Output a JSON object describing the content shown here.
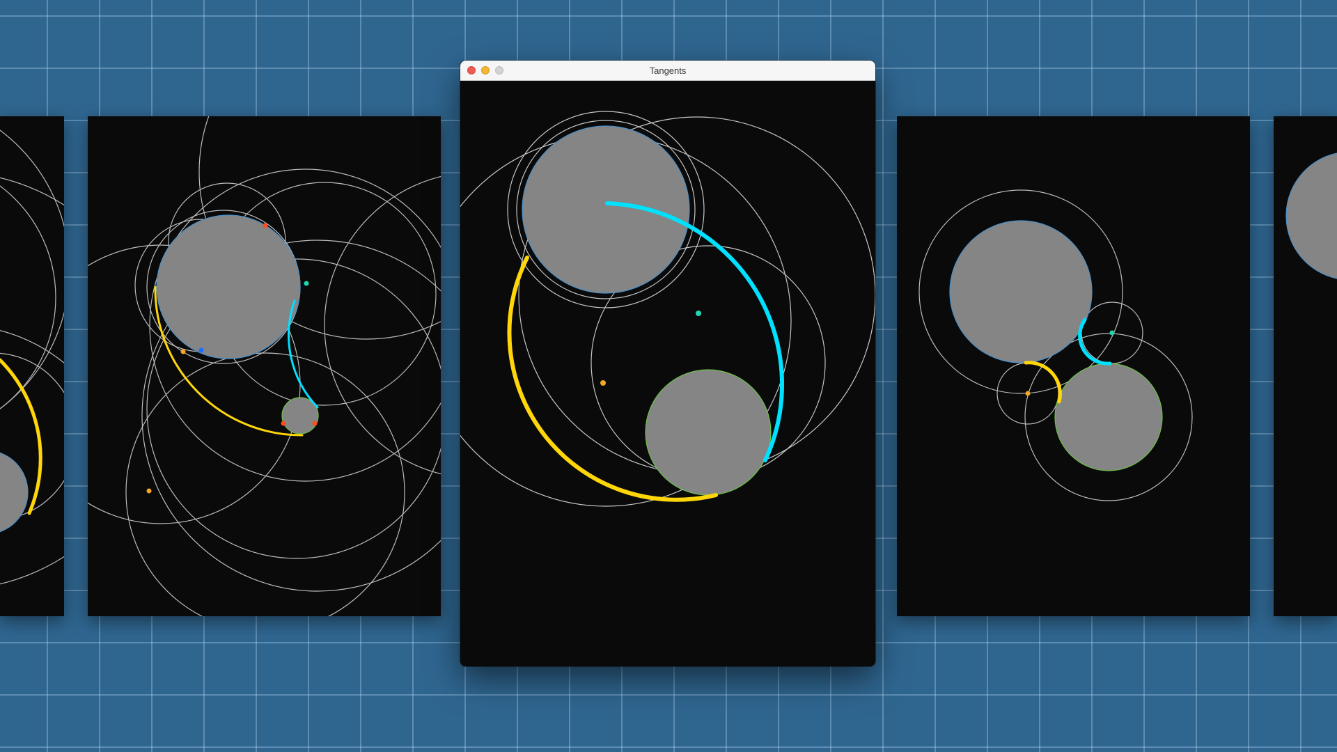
{
  "window": {
    "title": "Tangents",
    "controls": [
      "close",
      "minimize",
      "zoom"
    ]
  },
  "colors": {
    "desktop": "#2f6690",
    "grid": "#a9cbe6",
    "canvas": "#0a0a0a",
    "circle_fill": "#858585",
    "circle_a_stroke": "#4a90c8",
    "circle_b_stroke": "#6cc04a",
    "construction": "#dcdcdc",
    "arc_yellow": "#ffd60a",
    "arc_cyan": "#00e1ff",
    "point_orange": "#f5a623",
    "point_teal": "#20d7b0",
    "point_red": "#ff4d1f",
    "point_blue": "#1e6bff"
  },
  "panels": [
    {
      "name": "far-left-preview"
    },
    {
      "name": "left-preview"
    },
    {
      "name": "main-window"
    },
    {
      "name": "right-preview"
    },
    {
      "name": "far-right-preview"
    }
  ]
}
